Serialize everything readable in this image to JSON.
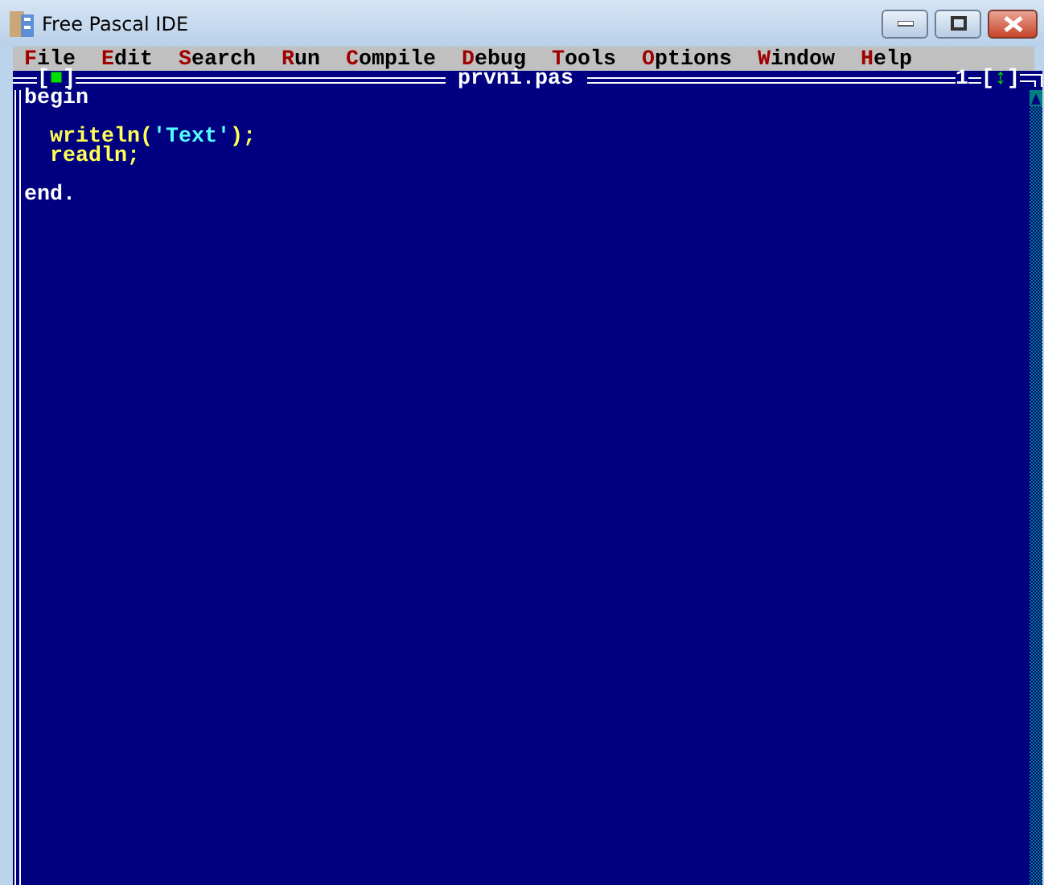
{
  "window": {
    "title": "Free Pascal IDE"
  },
  "menu": [
    {
      "hotkey": "F",
      "rest": "ile"
    },
    {
      "hotkey": "E",
      "rest": "dit"
    },
    {
      "hotkey": "S",
      "rest": "earch"
    },
    {
      "hotkey": "R",
      "rest": "un"
    },
    {
      "hotkey": "C",
      "rest": "ompile"
    },
    {
      "hotkey": "D",
      "rest": "ebug"
    },
    {
      "hotkey": "T",
      "rest": "ools"
    },
    {
      "hotkey": "O",
      "rest": "ptions"
    },
    {
      "hotkey": "W",
      "rest": "indow"
    },
    {
      "hotkey": "H",
      "rest": "elp"
    }
  ],
  "editor": {
    "close_button": "[■]",
    "title": "prvni.pas",
    "window_number": "1",
    "zoom_button": "[↕]",
    "lines": [
      {
        "kind": "code",
        "tokens": [
          {
            "kind": "keyword",
            "text": "begin"
          }
        ]
      },
      {
        "kind": "blank"
      },
      {
        "kind": "indented_code",
        "tokens": [
          {
            "kind": "identifier",
            "text": "writeln("
          },
          {
            "kind": "string",
            "text": "'Text'"
          },
          {
            "kind": "identifier",
            "text": ");"
          }
        ]
      },
      {
        "kind": "indented_code",
        "tokens": [
          {
            "kind": "identifier",
            "text": "readln;"
          }
        ]
      },
      {
        "kind": "blank"
      },
      {
        "kind": "code",
        "tokens": [
          {
            "kind": "keyword",
            "text": "end."
          }
        ]
      }
    ]
  }
}
